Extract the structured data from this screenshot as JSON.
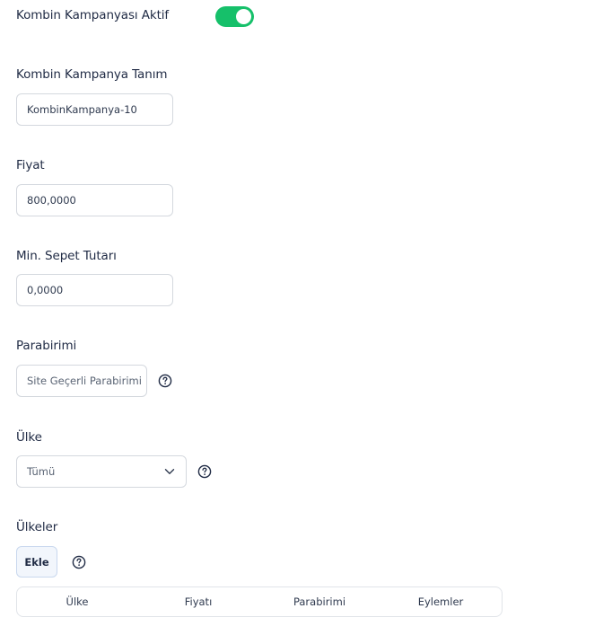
{
  "campaign_active": {
    "label": "Kombin Kampanyası Aktif",
    "enabled": true,
    "color": "#16c06a"
  },
  "definition": {
    "label": "Kombin Kampanya Tanım",
    "value": "KombinKampanya-10"
  },
  "price": {
    "label": "Fiyat",
    "value": "800,0000"
  },
  "min_basket": {
    "label": "Min. Sepet Tutarı",
    "value": "0,0000"
  },
  "currency": {
    "label": "Parabirimi",
    "selected": "Site Geçerli Parabirimi",
    "help_icon": "question-circle-icon"
  },
  "country": {
    "label": "Ülke",
    "selected": "Tümü",
    "help_icon": "question-circle-icon"
  },
  "countries": {
    "label": "Ülkeler",
    "add_button": "Ekle",
    "help_icon": "question-circle-icon",
    "table_headers": [
      "Ülke",
      "Fiyatı",
      "Parabirimi",
      "Eylemler"
    ]
  }
}
